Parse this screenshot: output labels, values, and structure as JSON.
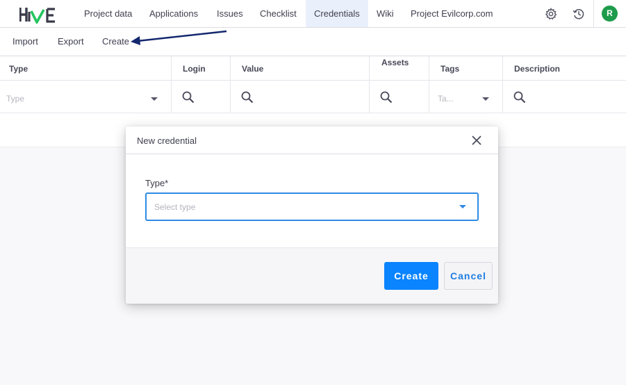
{
  "nav": {
    "items": [
      {
        "label": "Project data"
      },
      {
        "label": "Applications"
      },
      {
        "label": "Issues"
      },
      {
        "label": "Checklist"
      },
      {
        "label": "Credentials",
        "active": true
      },
      {
        "label": "Wiki"
      },
      {
        "label": "Project Evilcorp.com"
      }
    ],
    "icons": [
      "gear-icon",
      "history-icon"
    ],
    "avatar_letter": "R",
    "avatar_color": "#1e9c4c"
  },
  "actions": {
    "import": "Import",
    "export": "Export",
    "create": "Create"
  },
  "table": {
    "columns": [
      "Type",
      "Login",
      "Value",
      "Assets",
      "Tags",
      "Description"
    ],
    "filters": {
      "type_placeholder": "Type",
      "tags_placeholder": "Ta..."
    }
  },
  "modal": {
    "title": "New credential",
    "type_label": "Type*",
    "type_placeholder": "Select type",
    "create_label": "Create",
    "cancel_label": "Cancel"
  },
  "colors": {
    "accent": "#0a84ff",
    "active_tab_bg": "#eaf0fb",
    "annotation_arrow": "#14286e"
  }
}
